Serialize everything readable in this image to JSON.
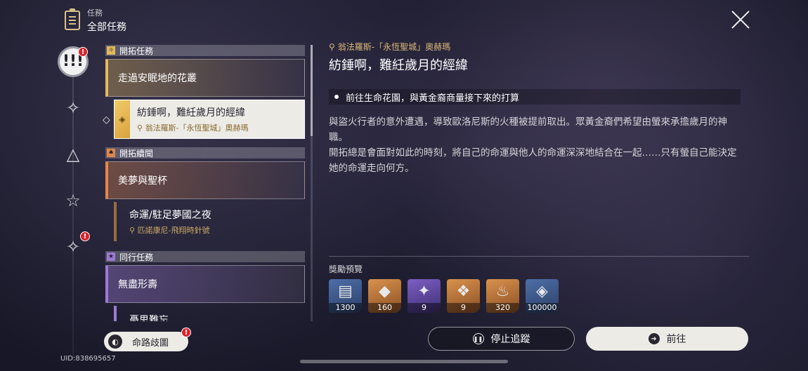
{
  "header": {
    "small": "任務",
    "title": "全部任務"
  },
  "rail": {
    "badge": "!"
  },
  "sections": [
    {
      "name": "開拓任務",
      "icon": "☼",
      "color": "#e3b95b"
    },
    {
      "name": "開拓續聞",
      "icon": "♠",
      "color": "#e2874a"
    },
    {
      "name": "同行任務",
      "icon": "★",
      "color": "#9b7bd4"
    }
  ],
  "quests": {
    "q1": "走過安眠地的花叢",
    "q1_sub_title": "紡錘啊，難紝歲月的經緯",
    "q1_sub_loc": "翁法羅斯-「永恆聖城」奧赫瑪",
    "q2": "美夢與聖杯",
    "q2_sub_title": "命運/駐足夢國之夜",
    "q2_sub_loc": "匹諾康尼-飛翔時針號",
    "q3": "無盡形壽",
    "q3_sub_title": "憂思難忘"
  },
  "detail": {
    "location": "翁法羅斯-「永恆聖城」奧赫瑪",
    "title": "紡錘啊，難紝歲月的經緯",
    "objective": "前往生命花園，與黃金裔商量接下來的打算",
    "desc1": "與盜火行者的意外遭遇，導致歐洛尼斯的火種被提前取出。眾黃金裔們希望由螢來承擔歲月的神職。",
    "desc2": "開拓總是會面對如此的時刻，將自己的命運與他人的命運深深地結合在一起……只有螢自己能決定她的命運走向何方。"
  },
  "rewards": {
    "label": "獎勵預覽",
    "items": [
      {
        "icon": "scroll-icon",
        "glyph": "▤",
        "count": "1300",
        "color": "blue"
      },
      {
        "icon": "crystal-icon",
        "glyph": "◆",
        "count": "160",
        "color": "orange"
      },
      {
        "icon": "gem-icon",
        "glyph": "✦",
        "count": "9",
        "color": "purple"
      },
      {
        "icon": "book-icon",
        "glyph": "❖",
        "count": "9",
        "color": "orange"
      },
      {
        "icon": "potion-icon",
        "glyph": "♨",
        "count": "320",
        "color": "orange"
      },
      {
        "icon": "credit-icon",
        "glyph": "◈",
        "count": "100000",
        "color": "blue"
      }
    ]
  },
  "buttons": {
    "stop": "停止追蹤",
    "go": "前往",
    "path": "命路歧圖"
  },
  "uid": "UID:838695657"
}
